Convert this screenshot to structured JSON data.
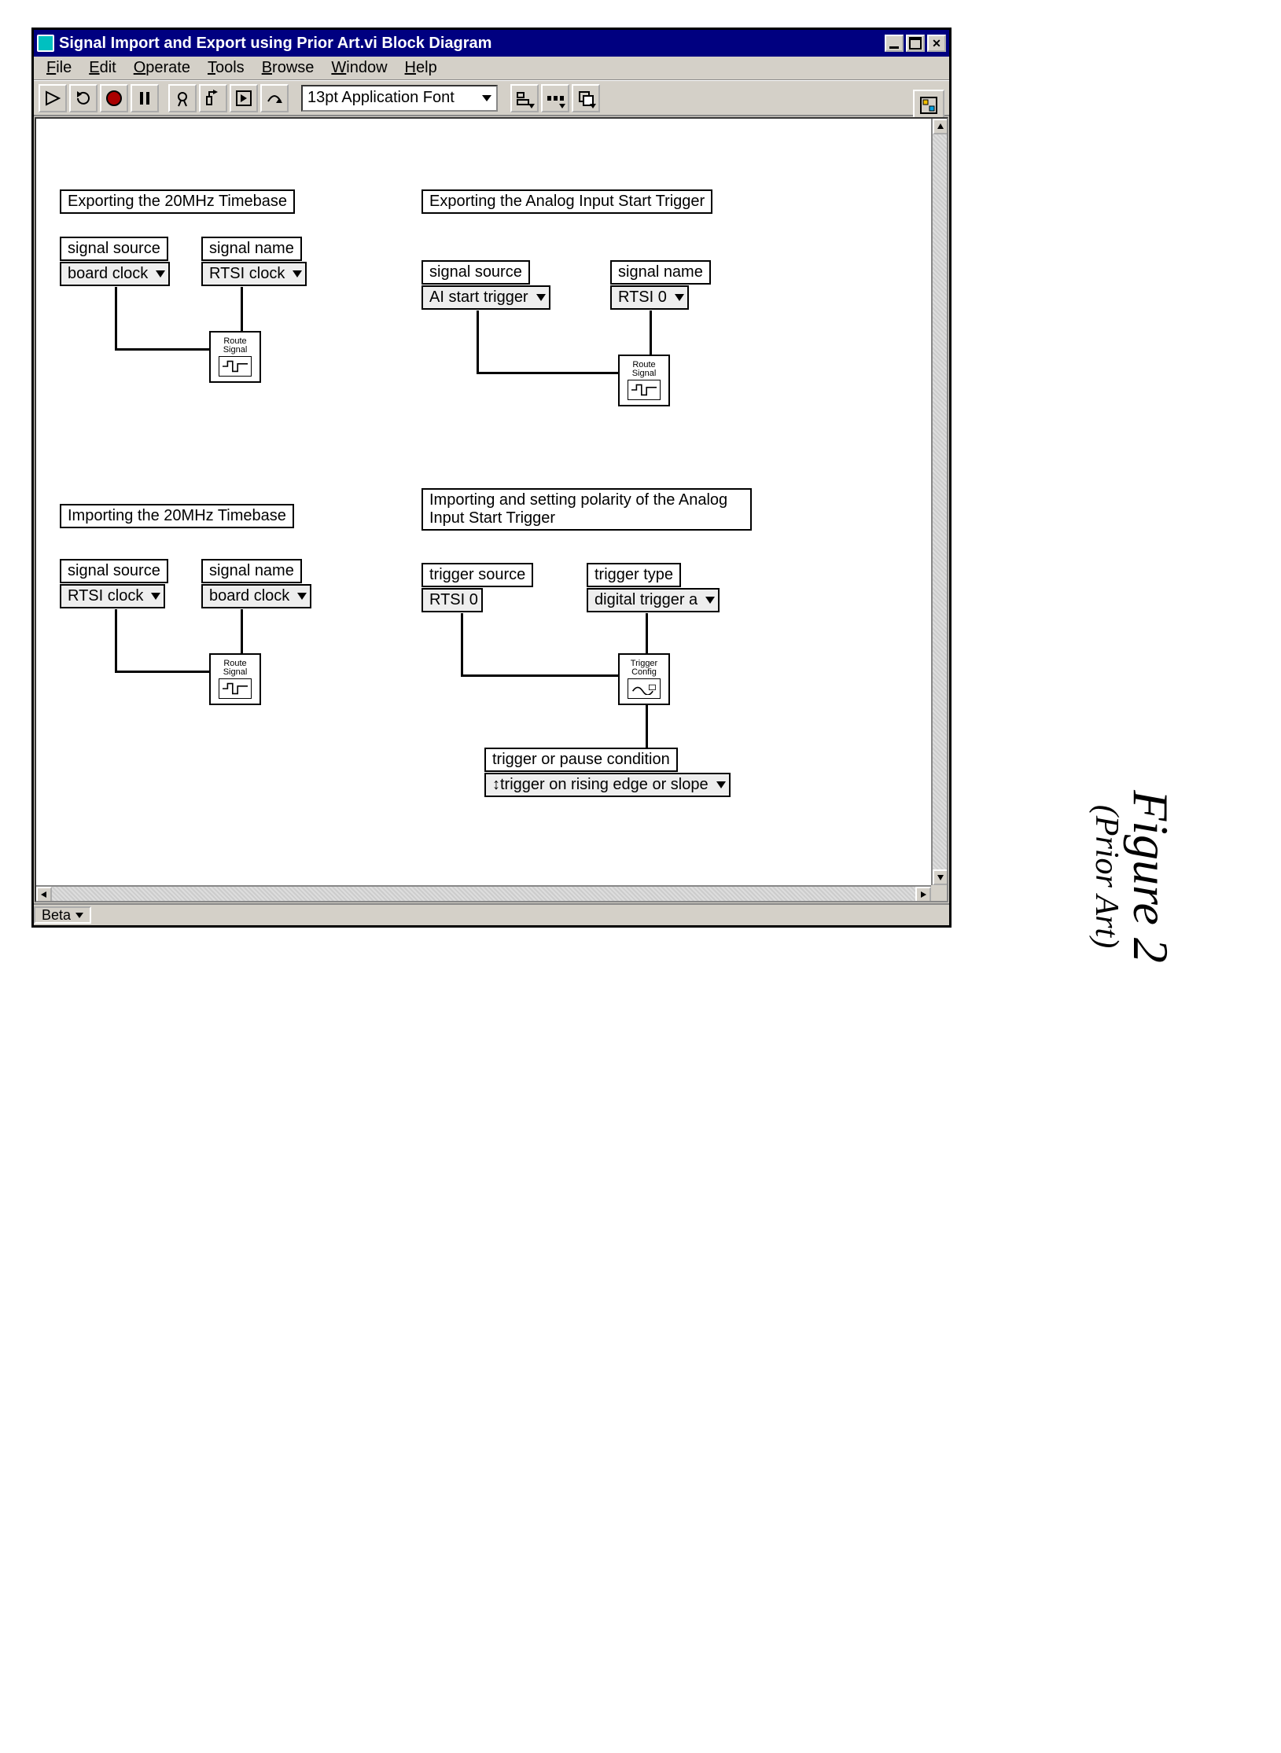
{
  "window": {
    "title": "Signal Import and Export using Prior Art.vi Block Diagram",
    "menu": [
      "File",
      "Edit",
      "Operate",
      "Tools",
      "Browse",
      "Window",
      "Help"
    ],
    "font_combo": "13pt Application Font",
    "status_pane": "Beta"
  },
  "groups": {
    "g1": {
      "title": "Exporting the 20MHz Timebase",
      "src_label": "signal source",
      "src_value": "board clock",
      "name_label": "signal name",
      "name_value": "RTSI clock",
      "node_label": "Route Signal"
    },
    "g2": {
      "title": "Exporting the Analog Input Start Trigger",
      "src_label": "signal source",
      "src_value": "AI start trigger",
      "name_label": "signal name",
      "name_value": "RTSI 0",
      "node_label": "Route Signal"
    },
    "g3": {
      "title": "Importing the 20MHz Timebase",
      "src_label": "signal source",
      "src_value": "RTSI clock",
      "name_label": "signal name",
      "name_value": "board clock",
      "node_label": "Route Signal"
    },
    "g4": {
      "title": "Importing and setting polarity of the Analog Input Start Trigger",
      "tsrc_label": "trigger source",
      "tsrc_value": "RTSI 0",
      "ttype_label": "trigger type",
      "ttype_value": "digital trigger a",
      "cond_label": "trigger or pause condition",
      "cond_value": "trigger on rising edge or slope",
      "node_label": "Trigger Config"
    }
  },
  "figure": {
    "main": "Figure 2",
    "sub": "(Prior Art)"
  }
}
